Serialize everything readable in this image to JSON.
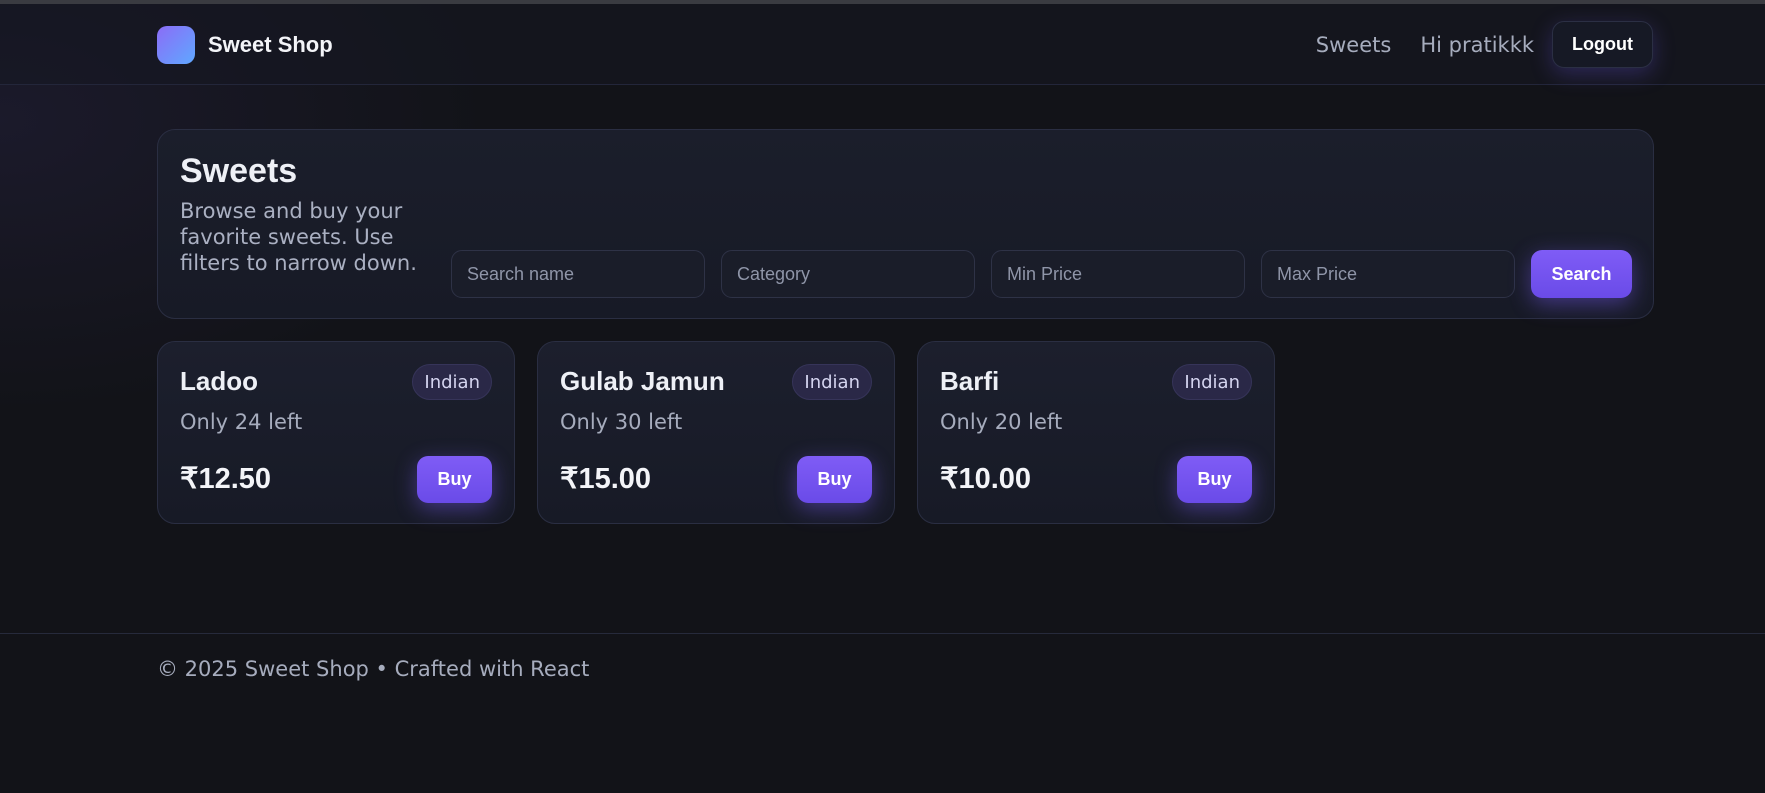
{
  "header": {
    "brand_name": "Sweet Shop",
    "nav_sweets": "Sweets",
    "greeting": "Hi pratikkk",
    "logout_label": "Logout"
  },
  "hero": {
    "title": "Sweets",
    "subtitle": "Browse and buy your favorite sweets. Use filters to narrow down.",
    "filters": {
      "name_placeholder": "Search name",
      "category_placeholder": "Category",
      "min_price_placeholder": "Min Price",
      "max_price_placeholder": "Max Price",
      "search_label": "Search"
    }
  },
  "sweets": [
    {
      "name": "Ladoo",
      "category": "Indian",
      "stock": "Only 24 left",
      "price": "₹12.50",
      "buy_label": "Buy"
    },
    {
      "name": "Gulab Jamun",
      "category": "Indian",
      "stock": "Only 30 left",
      "price": "₹15.00",
      "buy_label": "Buy"
    },
    {
      "name": "Barfi",
      "category": "Indian",
      "stock": "Only 20 left",
      "price": "₹10.00",
      "buy_label": "Buy"
    }
  ],
  "footer": {
    "text": "© 2025 Sweet Shop • Crafted with React"
  },
  "colors": {
    "background": "#121318",
    "accent": "#7458f2",
    "badge_bg": "#2a2847"
  },
  "icons": {
    "brand_logo": "gradient-square-logo"
  }
}
